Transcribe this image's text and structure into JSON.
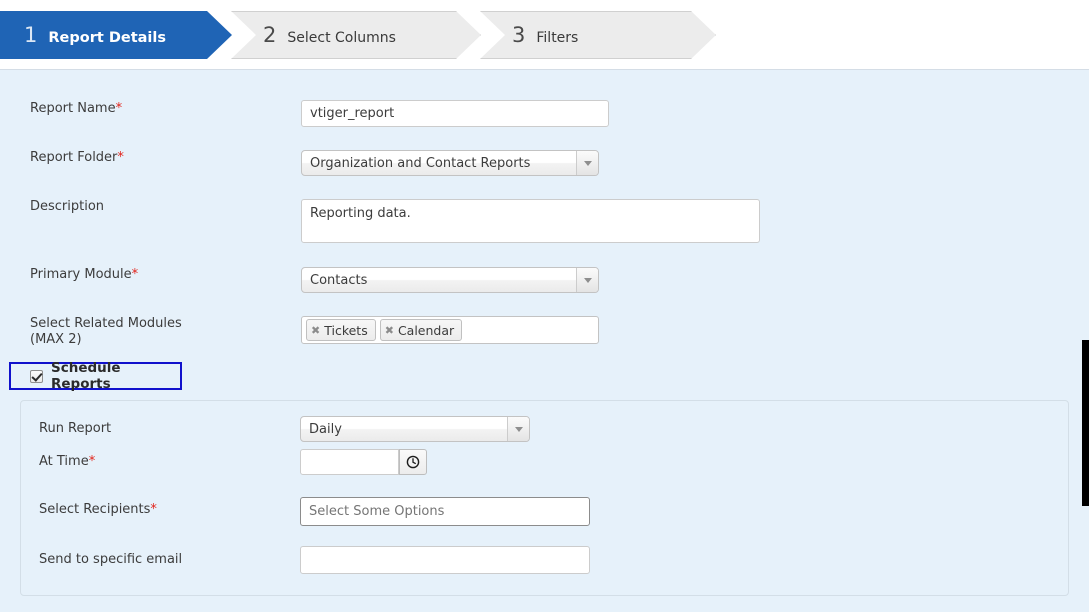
{
  "wizard": {
    "steps": [
      {
        "number": "1",
        "label": "Report Details",
        "state": "active"
      },
      {
        "number": "2",
        "label": "Select Columns",
        "state": "inactive"
      },
      {
        "number": "3",
        "label": "Filters",
        "state": "inactive"
      }
    ]
  },
  "form": {
    "report_name": {
      "label": "Report Name",
      "required_mark": "*",
      "value": "vtiger_report"
    },
    "report_folder": {
      "label": "Report Folder",
      "required_mark": "*",
      "value": "Organization and Contact Reports"
    },
    "description": {
      "label": "Description",
      "value": "Reporting data."
    },
    "primary_module": {
      "label": "Primary Module",
      "required_mark": "*",
      "value": "Contacts"
    },
    "related_modules": {
      "label": "Select Related Modules\n(MAX 2)",
      "tokens": [
        {
          "remove_glyph": "✖",
          "label": "Tickets"
        },
        {
          "remove_glyph": "✖",
          "label": "Calendar"
        }
      ]
    },
    "schedule_reports": {
      "label": "Schedule Reports",
      "checked": true
    }
  },
  "schedule": {
    "run_report": {
      "label": "Run Report",
      "value": "Daily"
    },
    "at_time": {
      "label": "At Time",
      "required_mark": "*",
      "value": "",
      "placeholder": ""
    },
    "select_recipients": {
      "label": "Select Recipients",
      "required_mark": "*",
      "value": "",
      "placeholder": "Select Some Options"
    },
    "send_to_specific_email": {
      "label": "Send to specific email",
      "value": "",
      "placeholder": ""
    }
  },
  "colors": {
    "active_step": "#1f64b5",
    "inactive_step": "#ececec",
    "panel_background": "#e6f1fa",
    "required_asterisk": "#e2231a",
    "focus_ring": "#1111cc"
  }
}
